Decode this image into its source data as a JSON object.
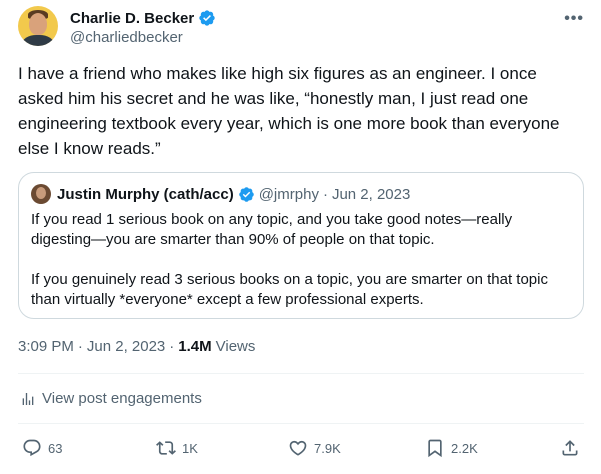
{
  "author": {
    "display_name": "Charlie D. Becker",
    "handle": "@charliedbecker",
    "verified_color": "#1d9bf0"
  },
  "more_label": "•••",
  "tweet_text": "I have a friend who makes like high six figures as an engineer. I once asked him his secret and he was like, “honestly man, I just read one engineering textbook every year, which is one more book than everyone else I know reads.”",
  "quote": {
    "display_name": "Justin Murphy (cath/acc)",
    "handle": "@jmrphy",
    "separator": "·",
    "date": "Jun 2, 2023",
    "paragraph_1": "If you read 1 serious book on any topic, and you take good notes—really digesting—you are smarter than 90% of people on that topic.",
    "paragraph_2": "If you genuinely read 3 serious books on a topic, you are smarter on that topic than virtually *everyone* except a few professional experts."
  },
  "meta": {
    "time": "3:09 PM",
    "separator_1": "·",
    "date": "Jun 2, 2023",
    "separator_2": "·",
    "views_count": "1.4M",
    "views_label": "Views"
  },
  "engagements_label": "View post engagements",
  "actions": {
    "replies": "63",
    "reposts": "1K",
    "likes": "7.9K",
    "bookmarks": "2.2K"
  },
  "icons": {
    "verified": "verified-badge-icon",
    "analytics": "analytics-icon",
    "reply": "reply-icon",
    "repost": "repost-icon",
    "like": "heart-icon",
    "bookmark": "bookmark-icon",
    "share": "share-icon"
  }
}
